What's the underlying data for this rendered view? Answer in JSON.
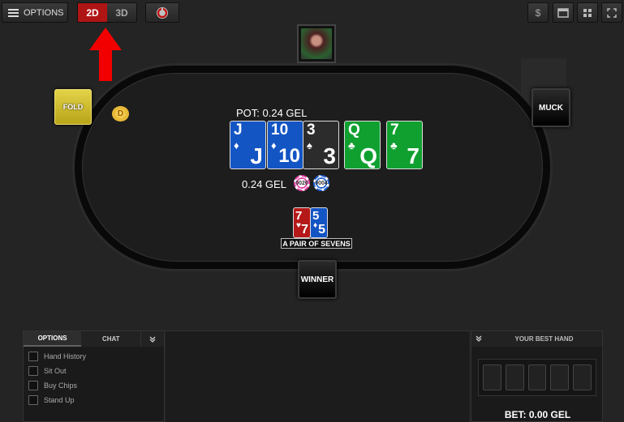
{
  "toolbar": {
    "options_label": "OPTIONS",
    "view_2d": "2D",
    "view_3d": "3D",
    "right_icons": [
      "dollar-icon",
      "window-icon",
      "grid-icon",
      "fullscreen-icon"
    ]
  },
  "table": {
    "pot_label": "POT: 0.24 GEL",
    "bet_amount": "0.24 GEL",
    "chip_1": "0020",
    "chip_2": "0004",
    "dealer_label": "D",
    "fold_label": "FOLD",
    "muck_label": "MUCK",
    "winner_label": "WINNER",
    "hand_label": "A PAIR OF SEVENS"
  },
  "board_cards": [
    {
      "rank": "J",
      "suit": "♦",
      "color": "blue"
    },
    {
      "rank": "10",
      "suit": "♦",
      "color": "blue"
    },
    {
      "rank": "3",
      "suit": "♠",
      "color": "dark"
    },
    {
      "rank": "Q",
      "suit": "♣",
      "color": "green"
    },
    {
      "rank": "7",
      "suit": "♣",
      "color": "green"
    }
  ],
  "hole_cards": [
    {
      "rank": "7",
      "suit": "♥",
      "color": "red"
    },
    {
      "rank": "5",
      "suit": "♦",
      "color": "blue"
    }
  ],
  "panel": {
    "tab_options": "OPTIONS",
    "tab_chat": "CHAT",
    "items": [
      "Hand History",
      "Sit Out",
      "Buy Chips",
      "Stand Up"
    ]
  },
  "best_hand": {
    "title": "YOUR BEST HAND",
    "bet": "BET: 0.00 GEL"
  },
  "colors": {
    "accent_red": "#b01515",
    "fold_yellow": "#d4c230",
    "card_blue": "#1455c4",
    "card_green": "#10a030",
    "card_red": "#b51818"
  }
}
